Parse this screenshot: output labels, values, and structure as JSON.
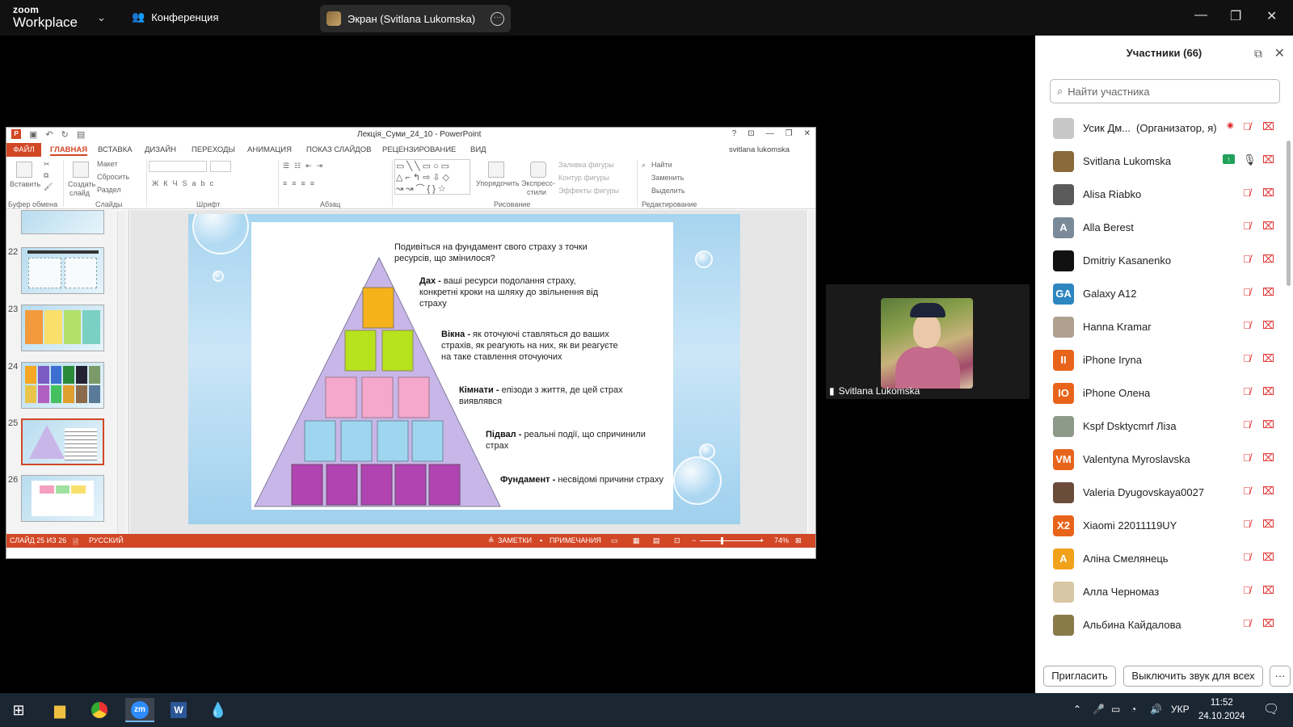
{
  "zoom": {
    "logo_line1": "zoom",
    "logo_line2": "Workplace",
    "conference_label": "Конференция",
    "screen_label": "Экран (Svitlana Lukomska)"
  },
  "ppt": {
    "window_title": "Лекція_Суми_24_10 - PowerPoint",
    "tabs": [
      "ФАЙЛ",
      "ГЛАВНАЯ",
      "ВСТАВКА",
      "ДИЗАЙН",
      "ПЕРЕХОДЫ",
      "АНИМАЦИЯ",
      "ПОКАЗ СЛАЙДОВ",
      "РЕЦЕНЗИРОВАНИЕ",
      "ВИД"
    ],
    "user": "svitlana lukomska",
    "ribbon": {
      "paste": "Вставить",
      "clipboard_group": "Буфер обмена",
      "layout": "Макет",
      "reset": "Сбросить",
      "section": "Раздел",
      "new_slide_1": "Создать",
      "new_slide_2": "слайд",
      "slides_group": "Слайды",
      "font_group": "Шрифт",
      "paragraph_group": "Абзац",
      "arrange": "Упорядочить",
      "quick_styles_1": "Экспресс-",
      "quick_styles_2": "стили",
      "shape_fill": "Заливка фигуры",
      "shape_outline": "Контур фигуры",
      "shape_effects": "Эффекты фигуры",
      "drawing_group": "Рисование",
      "find": "Найти",
      "replace": "Заменить",
      "select": "Выделить",
      "editing_group": "Редактирование"
    },
    "thumbnails": [
      "22",
      "23",
      "24",
      "25",
      "26"
    ],
    "slide": {
      "intro": "Подивіться на фундамент свого страху з точки ресурсів, що змінилося?",
      "roof_b": "Дах - ",
      "roof": "ваші ресурси подолання страху, конкретні кроки на шляху до звільнення від страху",
      "windows_b": "Вікна - ",
      "windows": "як оточуючі ставляться до ваших страхів, як реагують на них, як ви реагуєте на таке ставлення оточуючих",
      "rooms_b": "Кімнати - ",
      "rooms": "епізоди з життя, де цей страх виявлявся",
      "basement_b": "Підвал - ",
      "basement": "реальні події, що спричинили страх",
      "foundation_b": "Фундамент - ",
      "foundation": "несвідомі причини страху"
    },
    "status": {
      "slide_counter": "СЛАЙД 25 ИЗ 26",
      "language": "РУССКИЙ",
      "notes": "ЗАМЕТКИ",
      "comments": "ПРИМЕЧАНИЯ",
      "zoom": "74%"
    }
  },
  "video": {
    "name": "Svitlana Lukomska"
  },
  "participants": {
    "title": "Участники (66)",
    "search_placeholder": "Найти участника",
    "items": [
      {
        "name": "Усик Дм...",
        "note": "(Организатор, я)",
        "initials": "",
        "color": "#c7c7c7",
        "mic": "muted"
      },
      {
        "name": "Svitlana Lukomska",
        "note": "",
        "initials": "",
        "color": "#8a6a3a",
        "mic": "on"
      },
      {
        "name": "Alisa Riabko",
        "note": "",
        "initials": "",
        "color": "#5a5a5a",
        "mic": "muted"
      },
      {
        "name": "Alla Berest",
        "note": "",
        "initials": "A",
        "color": "#7a8a99",
        "mic": "muted"
      },
      {
        "name": "Dmitriy Kasanenko",
        "note": "",
        "initials": "",
        "color": "#111111",
        "mic": "muted"
      },
      {
        "name": "Galaxy A12",
        "note": "",
        "initials": "GA",
        "color": "#2e86c1",
        "mic": "muted"
      },
      {
        "name": "Hanna Kramar",
        "note": "",
        "initials": "",
        "color": "#b0a090",
        "mic": "muted"
      },
      {
        "name": "iPhone Iryna",
        "note": "",
        "initials": "II",
        "color": "#e8641b",
        "mic": "muted"
      },
      {
        "name": "iPhone Олена",
        "note": "",
        "initials": "IO",
        "color": "#e8641b",
        "mic": "muted"
      },
      {
        "name": "Kspf Dsktycmrf Ліза",
        "note": "",
        "initials": "",
        "color": "#8d9a8a",
        "mic": "muted"
      },
      {
        "name": "Valentyna Myroslavska",
        "note": "",
        "initials": "VM",
        "color": "#e8641b",
        "mic": "muted"
      },
      {
        "name": "Valeria Dyugovskaya0027",
        "note": "",
        "initials": "",
        "color": "#6b4c3b",
        "mic": "muted"
      },
      {
        "name": "Xiaomi 22011119UY",
        "note": "",
        "initials": "X2",
        "color": "#e8641b",
        "mic": "muted"
      },
      {
        "name": "Аліна Смелянець",
        "note": "",
        "initials": "A",
        "color": "#f0a21b",
        "mic": "muted"
      },
      {
        "name": "Алла Черномаз",
        "note": "",
        "initials": "",
        "color": "#d9c6a5",
        "mic": "muted"
      },
      {
        "name": "Альбина Кайдалова",
        "note": "",
        "initials": "",
        "color": "#8a7a4a",
        "mic": "muted"
      }
    ],
    "invite_button": "Пригласить",
    "mute_all_button": "Выключить звук для всех",
    "more_button": "···"
  },
  "taskbar": {
    "lang": "УКР",
    "time": "11:52",
    "date": "24.10.2024"
  }
}
